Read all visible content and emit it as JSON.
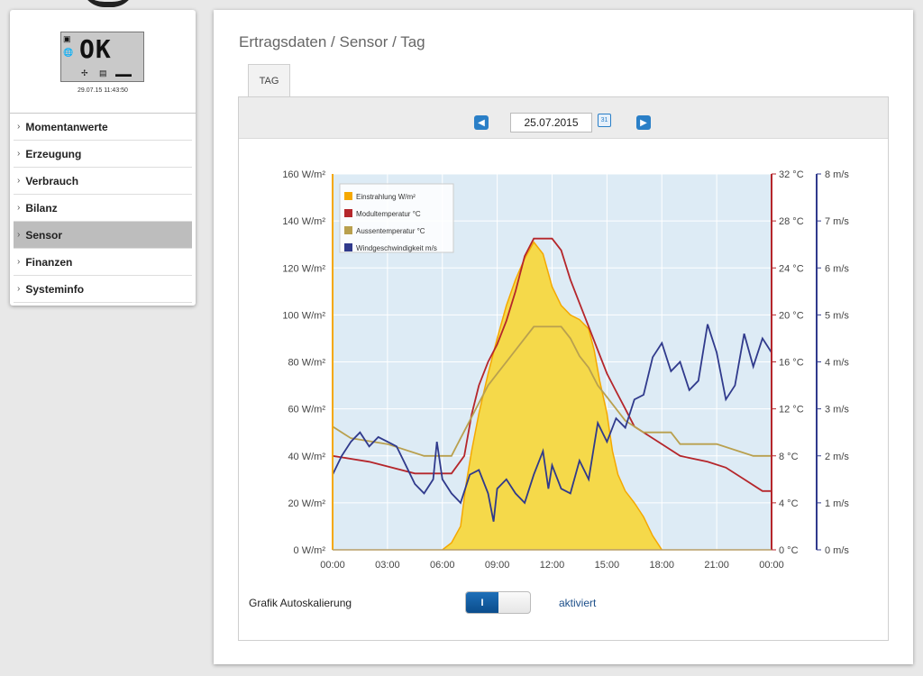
{
  "sidebar": {
    "lcd_text": "OK",
    "timestamp": "29.07.15 11:43:50",
    "menu": [
      {
        "label": "Momentanwerte",
        "active": false
      },
      {
        "label": "Erzeugung",
        "active": false
      },
      {
        "label": "Verbrauch",
        "active": false
      },
      {
        "label": "Bilanz",
        "active": false
      },
      {
        "label": "Sensor",
        "active": true
      },
      {
        "label": "Finanzen",
        "active": false
      },
      {
        "label": "Systeminfo",
        "active": false
      }
    ]
  },
  "main": {
    "breadcrumb": "Ertragsdaten / Sensor / Tag",
    "tab_label": "TAG",
    "date": "25.07.2015",
    "autoscale_label": "Grafik Autoskalierung",
    "toggle_on_label": "I",
    "autoscale_status": "aktiviert"
  },
  "icons": {
    "prev": "chevron-left-icon",
    "next": "chevron-right-icon",
    "calendar": "calendar-icon"
  },
  "colors": {
    "irradiance": "#f5a800",
    "irradiance_fill": "#f5d94a",
    "module_temp": "#b5262b",
    "outside_temp": "#b9a04e",
    "wind": "#303a8c",
    "plot_bg": "#ddebf5"
  },
  "chart_data": {
    "type": "line",
    "x_ticks": [
      "00:00",
      "03:00",
      "06:00",
      "09:00",
      "12:00",
      "15:00",
      "18:00",
      "21:00",
      "00:00"
    ],
    "x_range_hours": [
      0,
      24
    ],
    "axes": {
      "irradiance": {
        "unit": "W/m²",
        "ticks": [
          "0 W/m²",
          "20 W/m²",
          "40 W/m²",
          "60 W/m²",
          "80 W/m²",
          "100 W/m²",
          "120 W/m²",
          "140 W/m²",
          "160 W/m²"
        ],
        "range": [
          0,
          160
        ]
      },
      "temperature": {
        "unit": "°C",
        "ticks": [
          "0 °C",
          "4 °C",
          "8 °C",
          "12 °C",
          "16 °C",
          "20 °C",
          "24 °C",
          "28 °C",
          "32 °C"
        ],
        "range": [
          0,
          32
        ]
      },
      "wind": {
        "unit": "m/s",
        "ticks": [
          "0 m/s",
          "1 m/s",
          "2 m/s",
          "3 m/s",
          "4 m/s",
          "5 m/s",
          "6 m/s",
          "7 m/s",
          "8 m/s"
        ],
        "range": [
          0,
          8
        ]
      }
    },
    "grid": true,
    "legend_position": "top-left",
    "series": [
      {
        "name": "Einstrahlung W/m²",
        "axis": "irradiance",
        "style": "area",
        "points": [
          [
            0,
            0
          ],
          [
            6,
            0
          ],
          [
            6.5,
            3
          ],
          [
            7,
            10
          ],
          [
            7.3,
            28
          ],
          [
            7.6,
            42
          ],
          [
            8,
            58
          ],
          [
            8.5,
            75
          ],
          [
            9,
            90
          ],
          [
            9.5,
            104
          ],
          [
            10,
            115
          ],
          [
            10.5,
            124
          ],
          [
            11,
            131
          ],
          [
            11.5,
            126
          ],
          [
            12,
            112
          ],
          [
            12.5,
            104
          ],
          [
            13,
            100
          ],
          [
            13.5,
            98
          ],
          [
            14,
            94
          ],
          [
            14.3,
            85
          ],
          [
            14.6,
            72
          ],
          [
            15,
            58
          ],
          [
            15.3,
            42
          ],
          [
            15.6,
            32
          ],
          [
            16,
            25
          ],
          [
            16.5,
            20
          ],
          [
            17,
            14
          ],
          [
            17.5,
            6
          ],
          [
            18,
            0
          ],
          [
            24,
            0
          ]
        ]
      },
      {
        "name": "Modultemperatur °C",
        "axis": "temperature",
        "style": "step",
        "points": [
          [
            0,
            8
          ],
          [
            2,
            7.5
          ],
          [
            4.5,
            6.5
          ],
          [
            6.5,
            6.5
          ],
          [
            7.2,
            8
          ],
          [
            7.6,
            11.5
          ],
          [
            8,
            14
          ],
          [
            8.5,
            16
          ],
          [
            9,
            17.5
          ],
          [
            9.5,
            19.5
          ],
          [
            10,
            22
          ],
          [
            10.5,
            25
          ],
          [
            11,
            26.5
          ],
          [
            12,
            26.5
          ],
          [
            12.5,
            25.5
          ],
          [
            13,
            23
          ],
          [
            13.5,
            21
          ],
          [
            14,
            19
          ],
          [
            14.5,
            17
          ],
          [
            15,
            15
          ],
          [
            15.5,
            13.5
          ],
          [
            16,
            12
          ],
          [
            16.5,
            10.5
          ],
          [
            17,
            10
          ],
          [
            18,
            9
          ],
          [
            19,
            8
          ],
          [
            20.5,
            7.5
          ],
          [
            21.5,
            7
          ],
          [
            22.5,
            6
          ],
          [
            23.5,
            5
          ],
          [
            24,
            5
          ]
        ]
      },
      {
        "name": "Aussentemperatur °C",
        "axis": "temperature",
        "style": "step",
        "points": [
          [
            0,
            10.5
          ],
          [
            1,
            9.5
          ],
          [
            3,
            9
          ],
          [
            5,
            8
          ],
          [
            6.5,
            8
          ],
          [
            7,
            9.5
          ],
          [
            7.5,
            11
          ],
          [
            8,
            12.5
          ],
          [
            8.5,
            14
          ],
          [
            9,
            15
          ],
          [
            9.5,
            16
          ],
          [
            10,
            17
          ],
          [
            11,
            19
          ],
          [
            12.5,
            19
          ],
          [
            13,
            18
          ],
          [
            13.5,
            16.5
          ],
          [
            14,
            15.5
          ],
          [
            14.5,
            14
          ],
          [
            15,
            13
          ],
          [
            15.5,
            12
          ],
          [
            16,
            11
          ],
          [
            17,
            10
          ],
          [
            18.5,
            10
          ],
          [
            19,
            9
          ],
          [
            21,
            9
          ],
          [
            23,
            8
          ],
          [
            24,
            8
          ]
        ]
      },
      {
        "name": "Windgeschwindigkeit m/s",
        "axis": "wind",
        "style": "line",
        "points": [
          [
            0,
            1.6
          ],
          [
            0.5,
            2.0
          ],
          [
            1,
            2.3
          ],
          [
            1.5,
            2.5
          ],
          [
            2,
            2.2
          ],
          [
            2.5,
            2.4
          ],
          [
            3,
            2.3
          ],
          [
            3.5,
            2.2
          ],
          [
            4,
            1.8
          ],
          [
            4.5,
            1.4
          ],
          [
            5,
            1.2
          ],
          [
            5.5,
            1.5
          ],
          [
            5.7,
            2.3
          ],
          [
            6,
            1.5
          ],
          [
            6.5,
            1.2
          ],
          [
            7,
            1.0
          ],
          [
            7.5,
            1.6
          ],
          [
            8,
            1.7
          ],
          [
            8.5,
            1.2
          ],
          [
            8.8,
            0.6
          ],
          [
            9,
            1.3
          ],
          [
            9.5,
            1.5
          ],
          [
            10,
            1.2
          ],
          [
            10.5,
            1.0
          ],
          [
            11,
            1.6
          ],
          [
            11.5,
            2.1
          ],
          [
            11.8,
            1.3
          ],
          [
            12,
            1.8
          ],
          [
            12.5,
            1.3
          ],
          [
            13,
            1.2
          ],
          [
            13.5,
            1.9
          ],
          [
            14,
            1.5
          ],
          [
            14.5,
            2.7
          ],
          [
            15,
            2.3
          ],
          [
            15.5,
            2.8
          ],
          [
            16,
            2.6
          ],
          [
            16.5,
            3.2
          ],
          [
            17,
            3.3
          ],
          [
            17.5,
            4.1
          ],
          [
            18,
            4.4
          ],
          [
            18.5,
            3.8
          ],
          [
            19,
            4.0
          ],
          [
            19.5,
            3.4
          ],
          [
            20,
            3.6
          ],
          [
            20.5,
            4.8
          ],
          [
            21,
            4.2
          ],
          [
            21.5,
            3.2
          ],
          [
            22,
            3.5
          ],
          [
            22.5,
            4.6
          ],
          [
            23,
            3.9
          ],
          [
            23.5,
            4.5
          ],
          [
            24,
            4.2
          ]
        ]
      }
    ]
  }
}
